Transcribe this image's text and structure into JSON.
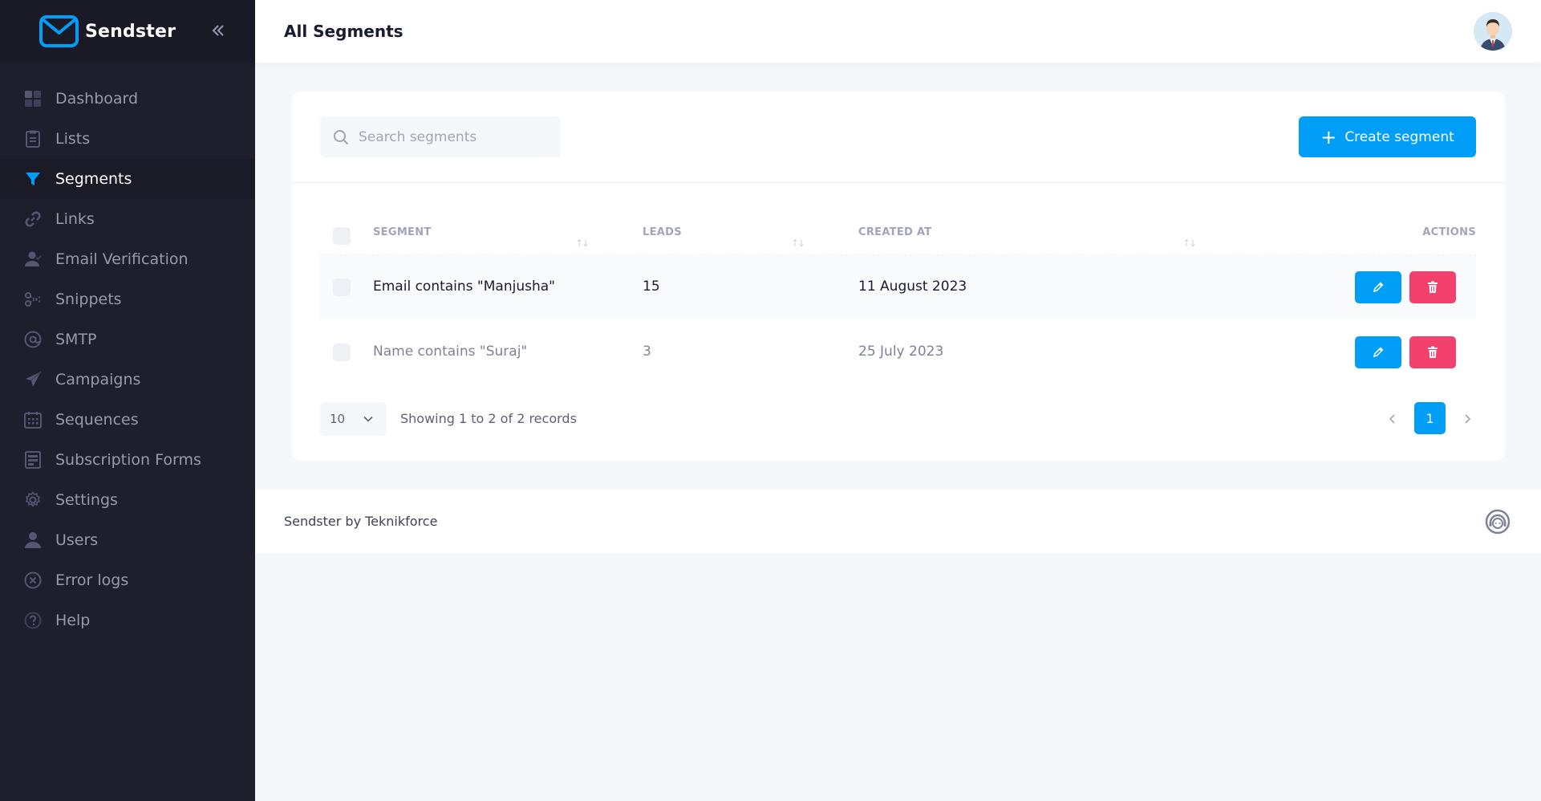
{
  "brand": {
    "name": "Sendster",
    "logo_icon": "envelope-logo-icon",
    "accent": "#009ef7"
  },
  "sidebar": {
    "collapse_icon": "double-chevron-left-icon",
    "items": [
      {
        "label": "Dashboard",
        "icon": "dashboard-icon",
        "active": false
      },
      {
        "label": "Lists",
        "icon": "clipboard-list-icon",
        "active": false
      },
      {
        "label": "Segments",
        "icon": "funnel-icon",
        "active": true
      },
      {
        "label": "Links",
        "icon": "link-icon",
        "active": false
      },
      {
        "label": "Email Verification",
        "icon": "user-check-icon",
        "active": false
      },
      {
        "label": "Snippets",
        "icon": "scissors-icon",
        "active": false
      },
      {
        "label": "SMTP",
        "icon": "at-sign-icon",
        "active": false
      },
      {
        "label": "Campaigns",
        "icon": "paper-plane-icon",
        "active": false
      },
      {
        "label": "Sequences",
        "icon": "calendar-icon",
        "active": false
      },
      {
        "label": "Subscription Forms",
        "icon": "form-icon",
        "active": false
      },
      {
        "label": "Settings",
        "icon": "gear-icon",
        "active": false
      },
      {
        "label": "Users",
        "icon": "user-icon",
        "active": false
      },
      {
        "label": "Error logs",
        "icon": "circle-x-icon",
        "active": false
      },
      {
        "label": "Help",
        "icon": "question-circle-icon",
        "active": false
      }
    ]
  },
  "header": {
    "title": "All Segments",
    "avatar_icon": "user-avatar-icon"
  },
  "toolbar": {
    "search_placeholder": "Search segments",
    "search_value": "",
    "create_label": "Create segment"
  },
  "table": {
    "columns": {
      "segment": "Segment",
      "leads": "Leads",
      "created_at": "Created At",
      "actions": "Actions"
    },
    "rows": [
      {
        "segment": "Email contains \"Manjusha\"",
        "leads": "15",
        "created_at": "11 August 2023"
      },
      {
        "segment": "Name contains \"Suraj\"",
        "leads": "3",
        "created_at": "25 July 2023"
      }
    ]
  },
  "pagination": {
    "page_size": "10",
    "info": "Showing 1 to 2 of 2 records",
    "current_page": "1"
  },
  "footer": {
    "text": "Sendster by Teknikforce",
    "support_icon": "support-headset-icon"
  },
  "colors": {
    "primary": "#009ef7",
    "danger": "#f1416c",
    "sidebar_bg": "#1e1e2d"
  }
}
